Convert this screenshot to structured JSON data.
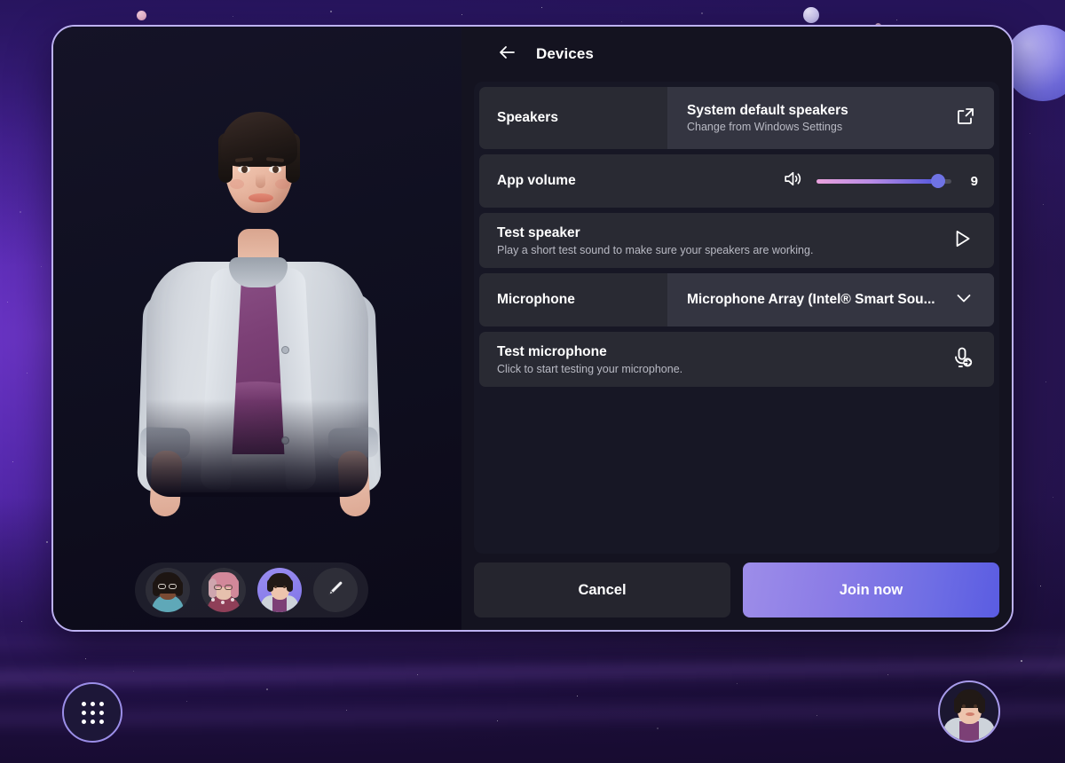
{
  "window": {
    "accent_border": "#bdb2f2",
    "pane_bg": "#141320"
  },
  "settings": {
    "header": {
      "back_icon": "arrow-left-icon",
      "title": "Devices"
    },
    "rows": [
      {
        "id": "speakers",
        "label": "Speakers",
        "value_title": "System default speakers",
        "value_sub": "Change from Windows Settings",
        "action_icon": "external-link-icon"
      },
      {
        "id": "app-volume",
        "label": "App volume",
        "icon": "speaker-volume-icon",
        "value": "9",
        "slider_percent": 90,
        "slider_gradient_from": "#eaa2dd",
        "slider_gradient_to": "#5257dd",
        "thumb_color": "#6f73e4"
      },
      {
        "id": "test-speaker",
        "title": "Test speaker",
        "subtitle": "Play a short test sound to make sure your speakers are working.",
        "action_icon": "play-icon"
      },
      {
        "id": "microphone",
        "label": "Microphone",
        "value_title": "Microphone Array (Intel® Smart Sou...",
        "action_icon": "chevron-down-icon"
      },
      {
        "id": "test-microphone",
        "title": "Test microphone",
        "subtitle": "Click to start testing your microphone.",
        "action_icon": "microphone-test-icon"
      }
    ],
    "footer": {
      "cancel_label": "Cancel",
      "join_label": "Join now",
      "join_gradient_from": "#9d8de9",
      "join_gradient_to": "#5a5ce2"
    }
  },
  "avatar_preview": {
    "description": "3D avatar with dark hair, grey cardigan and purple top"
  },
  "avatar_picker": {
    "items": [
      {
        "id": "avatar-1",
        "selected": false,
        "hair": "#1d1512",
        "skin": "#7a4a33",
        "outfit": "#5fa8b8"
      },
      {
        "id": "avatar-2",
        "selected": false,
        "hair": "#d2889a",
        "skin": "#e6c0ad",
        "outfit": "#8f3f58"
      },
      {
        "id": "avatar-3",
        "selected": true,
        "hair": "#211916",
        "skin": "#edc4ad",
        "outfit": "#7c4076",
        "bg": "#8d80ec"
      }
    ],
    "edit_icon": "pencil-icon"
  },
  "taskbar": {
    "launcher_icon": "grid-apps-icon",
    "user_avatar_icon": "user-avatar-icon"
  }
}
